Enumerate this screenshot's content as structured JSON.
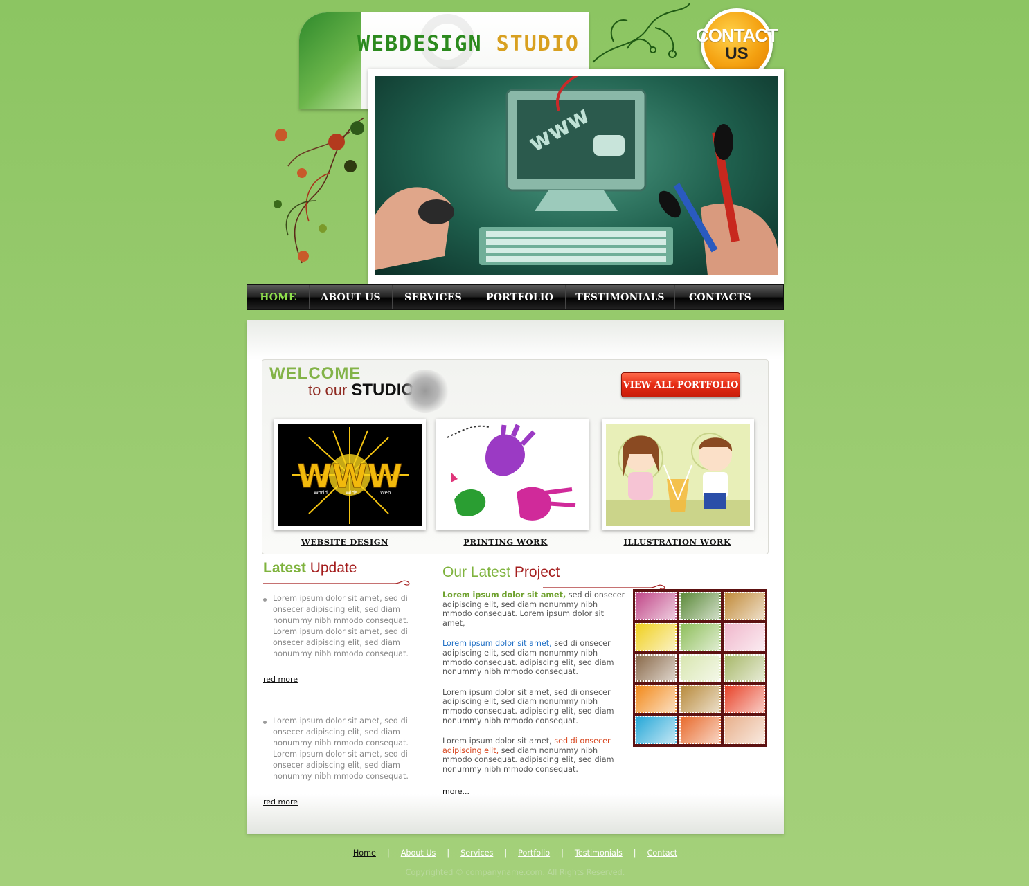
{
  "brand": {
    "logo_part1": "WEBDESIGN",
    "logo_part2": "STUDIO",
    "contact_line1": "CONTACT",
    "contact_line2": "US"
  },
  "hero": {
    "screen_text": "www"
  },
  "nav": {
    "items": [
      "HOME",
      "ABOUT US",
      "SERVICES",
      "PORTFOLIO",
      "TESTIMONIALS",
      "CONTACTS"
    ],
    "active": "HOME"
  },
  "welcome": {
    "title_line1": "WELCOME",
    "title_line2_prefix": "to our",
    "title_line2_bold": "STUDIO",
    "portfolio_button": "VIEW ALL PORTFOLIO",
    "thumbs": [
      {
        "label": "WEBSITE DESIGN",
        "image": "www-world-wide-web",
        "www_text": "WWW",
        "sub_labels": [
          "World",
          "Wide",
          "Web"
        ]
      },
      {
        "label": "PRINTING WORK",
        "image": "paint-hand-prints"
      },
      {
        "label": "ILLUSTRATION WORK",
        "image": "cartoon-couple"
      }
    ]
  },
  "latest_update": {
    "title_part1": "Latest",
    "title_part2": "Update",
    "items": [
      "Lorem ipsum dolor sit amet, sed di onsecer adipiscing elit, sed diam nonummy nibh mmodo consequat. Lorem ipsum dolor sit amet, sed di onsecer adipiscing elit, sed diam nonummy nibh mmodo consequat.",
      "Lorem ipsum dolor sit amet, sed di onsecer adipiscing elit, sed diam nonummy nibh mmodo consequat. Lorem ipsum dolor sit amet, sed di onsecer adipiscing elit, sed diam nonummy nibh mmodo consequat."
    ],
    "read_more": "red more"
  },
  "latest_project": {
    "title_part1": "Our Latest",
    "title_part2": "Project",
    "p1_bold": "Lorem ipsum dolor sit amet,",
    "p1_rest": " sed di onsecer adipiscing elit, sed diam nonummy nibh mmodo consequat. Lorem ipsum dolor sit amet,",
    "p2_link": "Lorem ipsum dolor sit amet,",
    "p2_rest": " sed di onsecer adipiscing elit, sed diam nonummy nibh mmodo consequat. adipiscing elit, sed diam nonummy nibh mmodo consequat.",
    "p3": "Lorem ipsum dolor sit amet, sed di onsecer adipiscing elit, sed diam nonummy nibh mmodo consequat. adipiscing elit, sed diam nonummy nibh mmodo consequat.",
    "p4_start": "Lorem ipsum dolor sit amet, ",
    "p4_red": "sed di onsecer adipiscing elit,",
    "p4_rest": " sed diam nonummy nibh mmodo consequat. adipiscing elit, sed diam nonummy nibh mmodo consequat.",
    "more": "more...",
    "stamp_colors": [
      "#c24a8a",
      "#5c8a3a",
      "#c28c3c",
      "#f0d022",
      "#8fbf5c",
      "#f0b8cc",
      "#8a6a4a",
      "#d8e6b0",
      "#a8b86a",
      "#f28a1c",
      "#b88a3c",
      "#e8442a",
      "#28a8d8",
      "#e86a2c",
      "#e8b08c"
    ]
  },
  "footer": {
    "links": [
      "Home",
      "About Us",
      "Services",
      "Portfolio",
      "Testimonials",
      "Contact"
    ],
    "copyright": "Copyrighted © companyname.com. All Rights Reserved."
  },
  "colors": {
    "background": "#9ccc72",
    "nav_active": "#8fe04d",
    "accent_green": "#7fb33e",
    "accent_red": "#e52b14",
    "logo_green": "#2c8a1e",
    "logo_gold": "#d8a020"
  }
}
